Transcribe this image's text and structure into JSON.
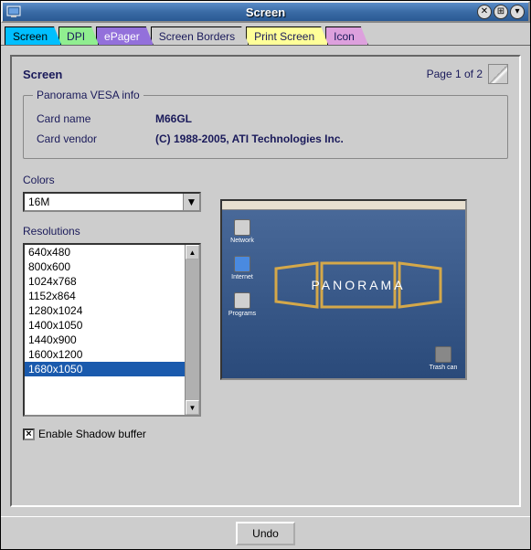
{
  "window": {
    "title": "Screen"
  },
  "tabs": [
    {
      "label": "Screen"
    },
    {
      "label": "DPI"
    },
    {
      "label": "ePager"
    },
    {
      "label": "Screen Borders"
    },
    {
      "label": "Print Screen"
    },
    {
      "label": "Icon"
    }
  ],
  "panel": {
    "title": "Screen",
    "page_indicator": "Page 1 of 2"
  },
  "vesa": {
    "legend": "Panorama VESA info",
    "card_name_label": "Card name",
    "card_name_value": "M66GL",
    "card_vendor_label": "Card vendor",
    "card_vendor_value": "(C) 1988-2005, ATI Technologies Inc."
  },
  "colors": {
    "label": "Colors",
    "selected": "16M"
  },
  "resolutions": {
    "label": "Resolutions",
    "items": [
      "640x480",
      "800x600",
      "1024x768",
      "1152x864",
      "1280x1024",
      "1400x1050",
      "1440x900",
      "1600x1200",
      "1680x1050"
    ],
    "selected_index": 8
  },
  "shadow_buffer": {
    "label": "Enable Shadow buffer",
    "checked": true
  },
  "preview_icons": {
    "network": "Network",
    "internet": "Internet",
    "programs": "Programs",
    "trash": "Trash can",
    "logo_text": "PANORAMA"
  },
  "footer": {
    "undo": "Undo"
  }
}
